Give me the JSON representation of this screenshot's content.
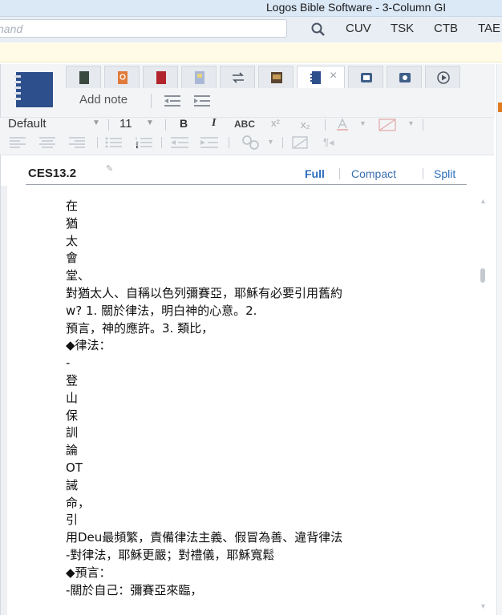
{
  "window": {
    "title": "Logos Bible Software - 3-Column GI"
  },
  "command": {
    "placeholder": "nand",
    "links": [
      "CUV",
      "TSK",
      "CTB",
      "TAE"
    ]
  },
  "panel": {
    "add_note": "Add note",
    "format": {
      "style": "Default",
      "size": "11",
      "bold": "B",
      "italic": "I",
      "caps": "ABC",
      "superscript": "x²",
      "subscript": "x₂"
    },
    "note_id": "CES13.2",
    "views": [
      "Full",
      "Compact",
      "Split"
    ],
    "content_lines": [
      "在",
      "猶",
      "太",
      "會",
      "堂、",
      "對猶太人、自稱以色列彌賽亞，耶穌有必要引用舊約",
      "w? 1. 關於律法，明白神的心意。2.",
      "預言，神的應許。3. 類比，",
      "◆律法：",
      "-",
      "登",
      "山",
      "保",
      "訓",
      "論",
      "OT",
      "誡",
      "命，",
      "引",
      "用Deu最頻繁，責備律法主義、假冒為善、違背律法",
      "-對律法，耶穌更嚴；對禮儀，耶穌寬鬆",
      "◆預言：",
      "-關於自己：彌賽亞來臨，"
    ]
  }
}
